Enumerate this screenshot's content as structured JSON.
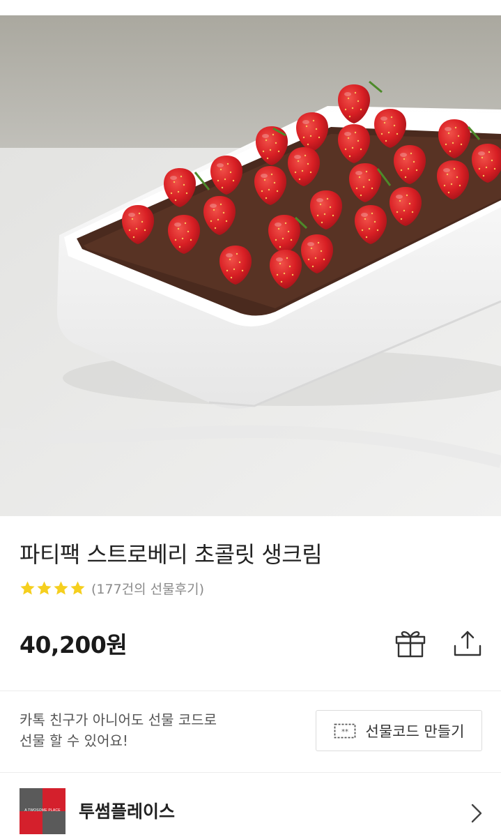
{
  "product": {
    "title": "파티팩 스트로베리 초콜릿 생크림",
    "rating_stars": 4,
    "review_count_text": "(177건의 선물후기)",
    "price": "40,200원",
    "image": "strawberry-chocolate-cream-cake-photo"
  },
  "actions": {
    "gift_icon": "gift-icon",
    "share_icon": "share-icon"
  },
  "promo": {
    "line1": "카톡 친구가 아니어도 선물 코드로",
    "line2": "선물 할 수 있어요!",
    "code_button_label": "선물코드 만들기",
    "code_button_icon": "ticket-icon"
  },
  "brand": {
    "name": "투썸플레이스",
    "logo_text": "A TWOSOME PLACE",
    "chevron_icon": "chevron-right-icon"
  },
  "colors": {
    "star": "#f5cf1e",
    "brand_red": "#d4202c",
    "brand_gray": "#5a5a5a",
    "price_text": "#1a1a1a"
  }
}
